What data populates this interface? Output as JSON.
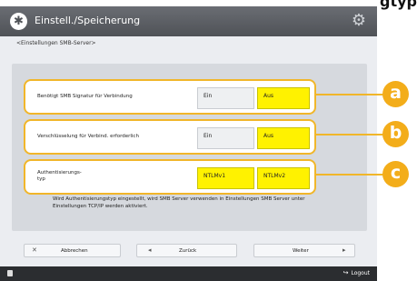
{
  "clipped_title": "gtyp",
  "titlebar": {
    "title": "Einstell./Speicherung"
  },
  "breadcrumb": "<Einstellungen SMB-Server>",
  "rows": [
    {
      "label": "Benötigt SMB Signatur für Verbindung",
      "options": [
        "Ein",
        "Aus"
      ],
      "selected": "Aus",
      "badge": "a"
    },
    {
      "label": "Verschlüsselung für Verbind. erforderlich",
      "options": [
        "Ein",
        "Aus"
      ],
      "selected": "Aus",
      "badge": "b"
    },
    {
      "label_line1": "Authentisierungs-",
      "label_line2": "typ",
      "options": [
        "NTLMv1",
        "NTLMv2"
      ],
      "selected": "NTLMv1, NTLMv2",
      "badge": "c"
    }
  ],
  "info": "Wird Authentisierungstyp eingestellt, wird SMB Server verwenden in Einstellungen SMB Server unter Einstellungen TCP/IP werden aktiviert.",
  "buttons": {
    "cancel": "Abbrechen",
    "back": "Zurück",
    "next": "Weiter"
  },
  "status": {
    "logout": "Logout"
  },
  "icons": {
    "app": "scanner-store-icon",
    "settings": "gear-icon",
    "cancel": "close-icon",
    "back": "arrow-left-icon",
    "next": "arrow-right-icon",
    "logout": "logout-icon"
  },
  "colors": {
    "highlight": "#f1b62a",
    "selected": "#fff200",
    "badge": "#f3ad1a"
  }
}
